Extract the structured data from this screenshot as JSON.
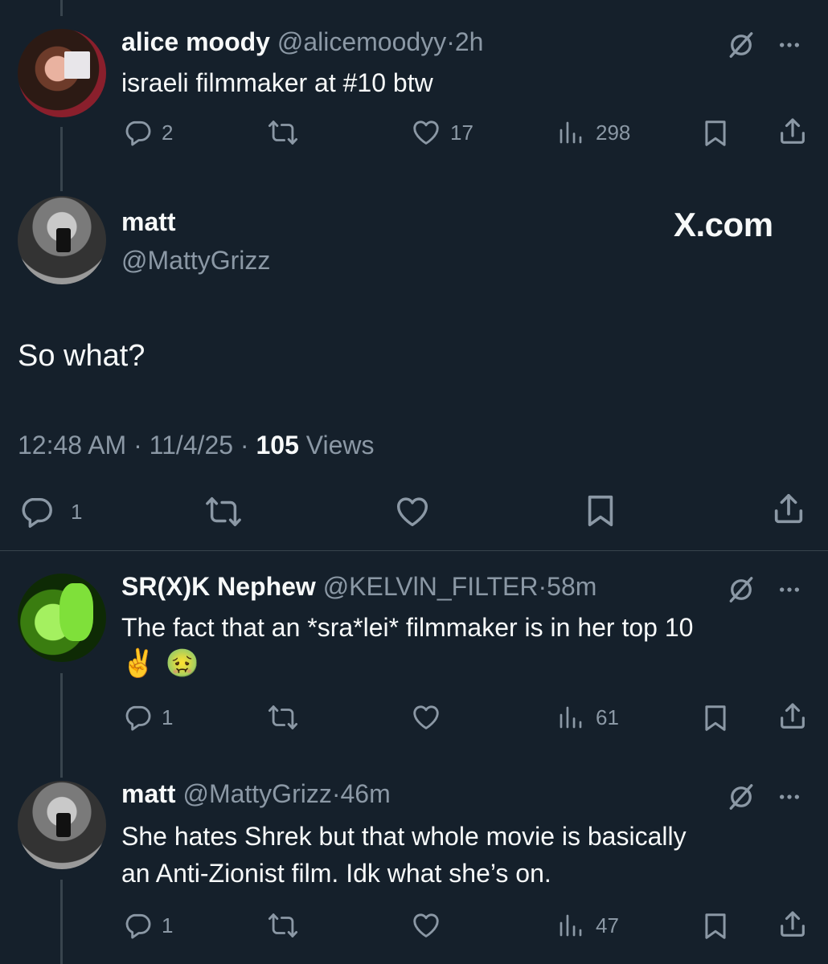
{
  "tweet1": {
    "name": "alice moody",
    "handle": "@alicemoodyy",
    "sep": "·",
    "time": "2h",
    "text": "israeli filmmaker at #10 btw",
    "replies": "2",
    "likes": "17",
    "views": "298"
  },
  "main": {
    "name": "matt",
    "handle": "@MattyGrizz",
    "brand": "X.com",
    "text": "So what?",
    "time": "12:48 AM",
    "date": "11/4/25",
    "views_count": "105",
    "views_label": "Views",
    "sep": "·",
    "replies": "1"
  },
  "tweet3": {
    "name": "SR(X)K Nephew",
    "handle": "@KELVlN_FILTER",
    "sep": "·",
    "time": "58m",
    "text": "The fact that an *sra*lei* filmmaker is in her top 10",
    "emoji1": "✌️",
    "emoji2": "🤢",
    "replies": "1",
    "views": "61"
  },
  "tweet4": {
    "name": "matt",
    "handle": "@MattyGrizz",
    "sep": "·",
    "time": "46m",
    "text_line1": "She hates Shrek but that whole movie is basically",
    "text_line2": "an Anti-Zionist film. Idk what she’s on.",
    "replies": "1",
    "views": "47"
  },
  "icons": {
    "reply": "reply-icon",
    "retweet": "retweet-icon",
    "like": "heart-icon",
    "views": "views-icon",
    "bookmark": "bookmark-icon",
    "share": "share-icon",
    "grok": "grok-icon",
    "more": "more-icon"
  },
  "colors": {
    "background": "#15202b",
    "text": "#f7f9f9",
    "muted": "#8b98a5",
    "line": "#38444d"
  }
}
